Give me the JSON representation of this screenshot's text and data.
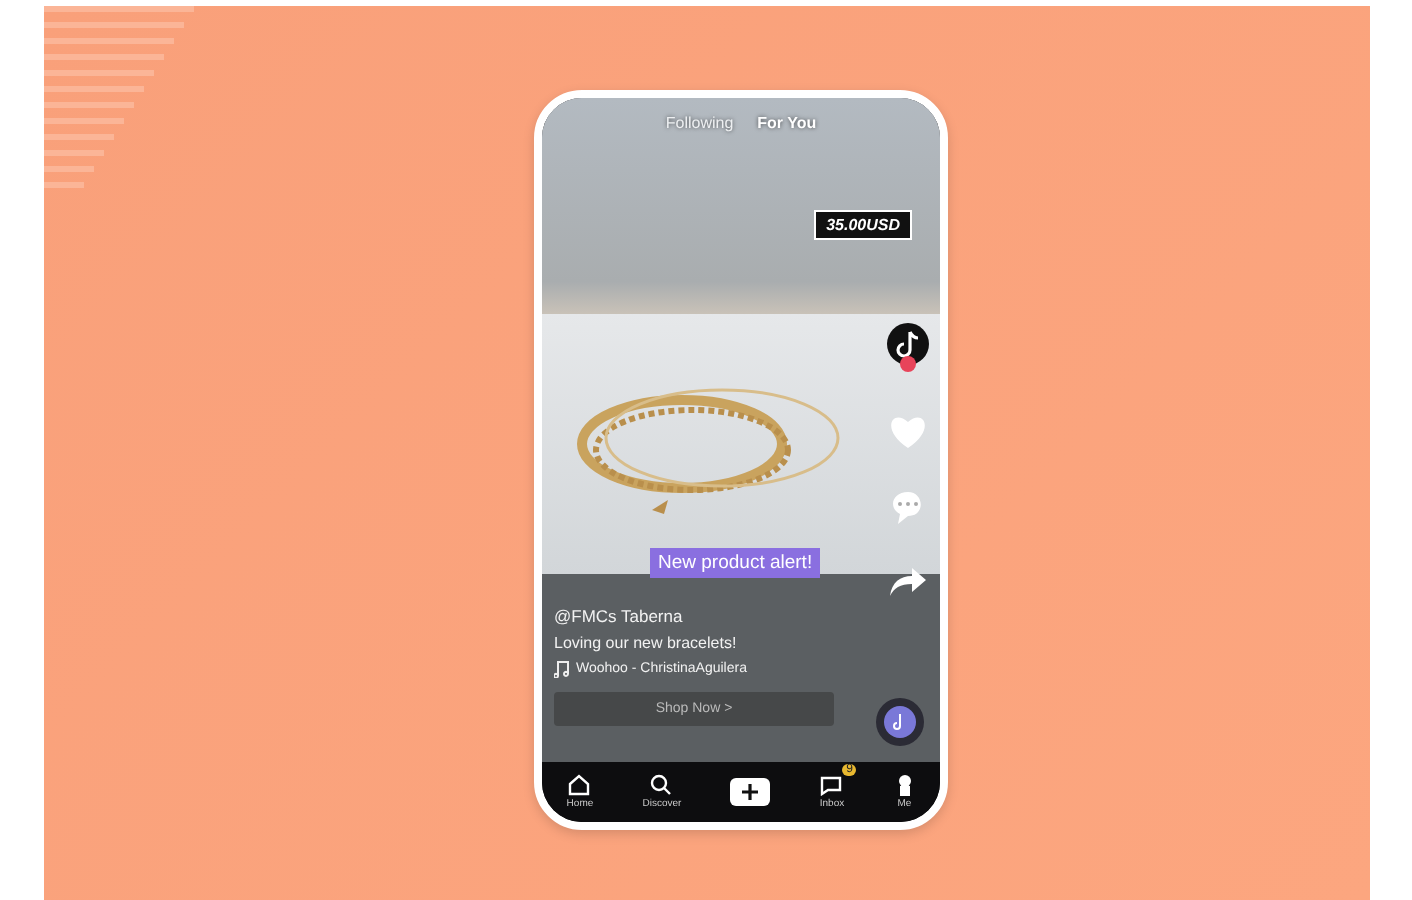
{
  "feed_tabs": [
    {
      "label": "Following",
      "selected": false
    },
    {
      "label": "For You",
      "selected": true
    }
  ],
  "price_tag": "35.00USD",
  "caption_sticker": "New product alert!",
  "actions": [
    {
      "kind": "profile"
    },
    {
      "kind": "like"
    },
    {
      "kind": "comment"
    },
    {
      "kind": "share"
    }
  ],
  "author": "@FMCs Taberna",
  "description": "Loving our new bracelets!",
  "sound": "Woohoo - ChristinaAguilera",
  "shop_button": "Shop Now >",
  "nav": [
    {
      "kind": "home",
      "label": "Home"
    },
    {
      "kind": "search",
      "label": "Discover"
    },
    {
      "kind": "create"
    },
    {
      "kind": "inbox",
      "label": "Inbox",
      "badge": "9"
    },
    {
      "kind": "me",
      "label": "Me"
    }
  ]
}
